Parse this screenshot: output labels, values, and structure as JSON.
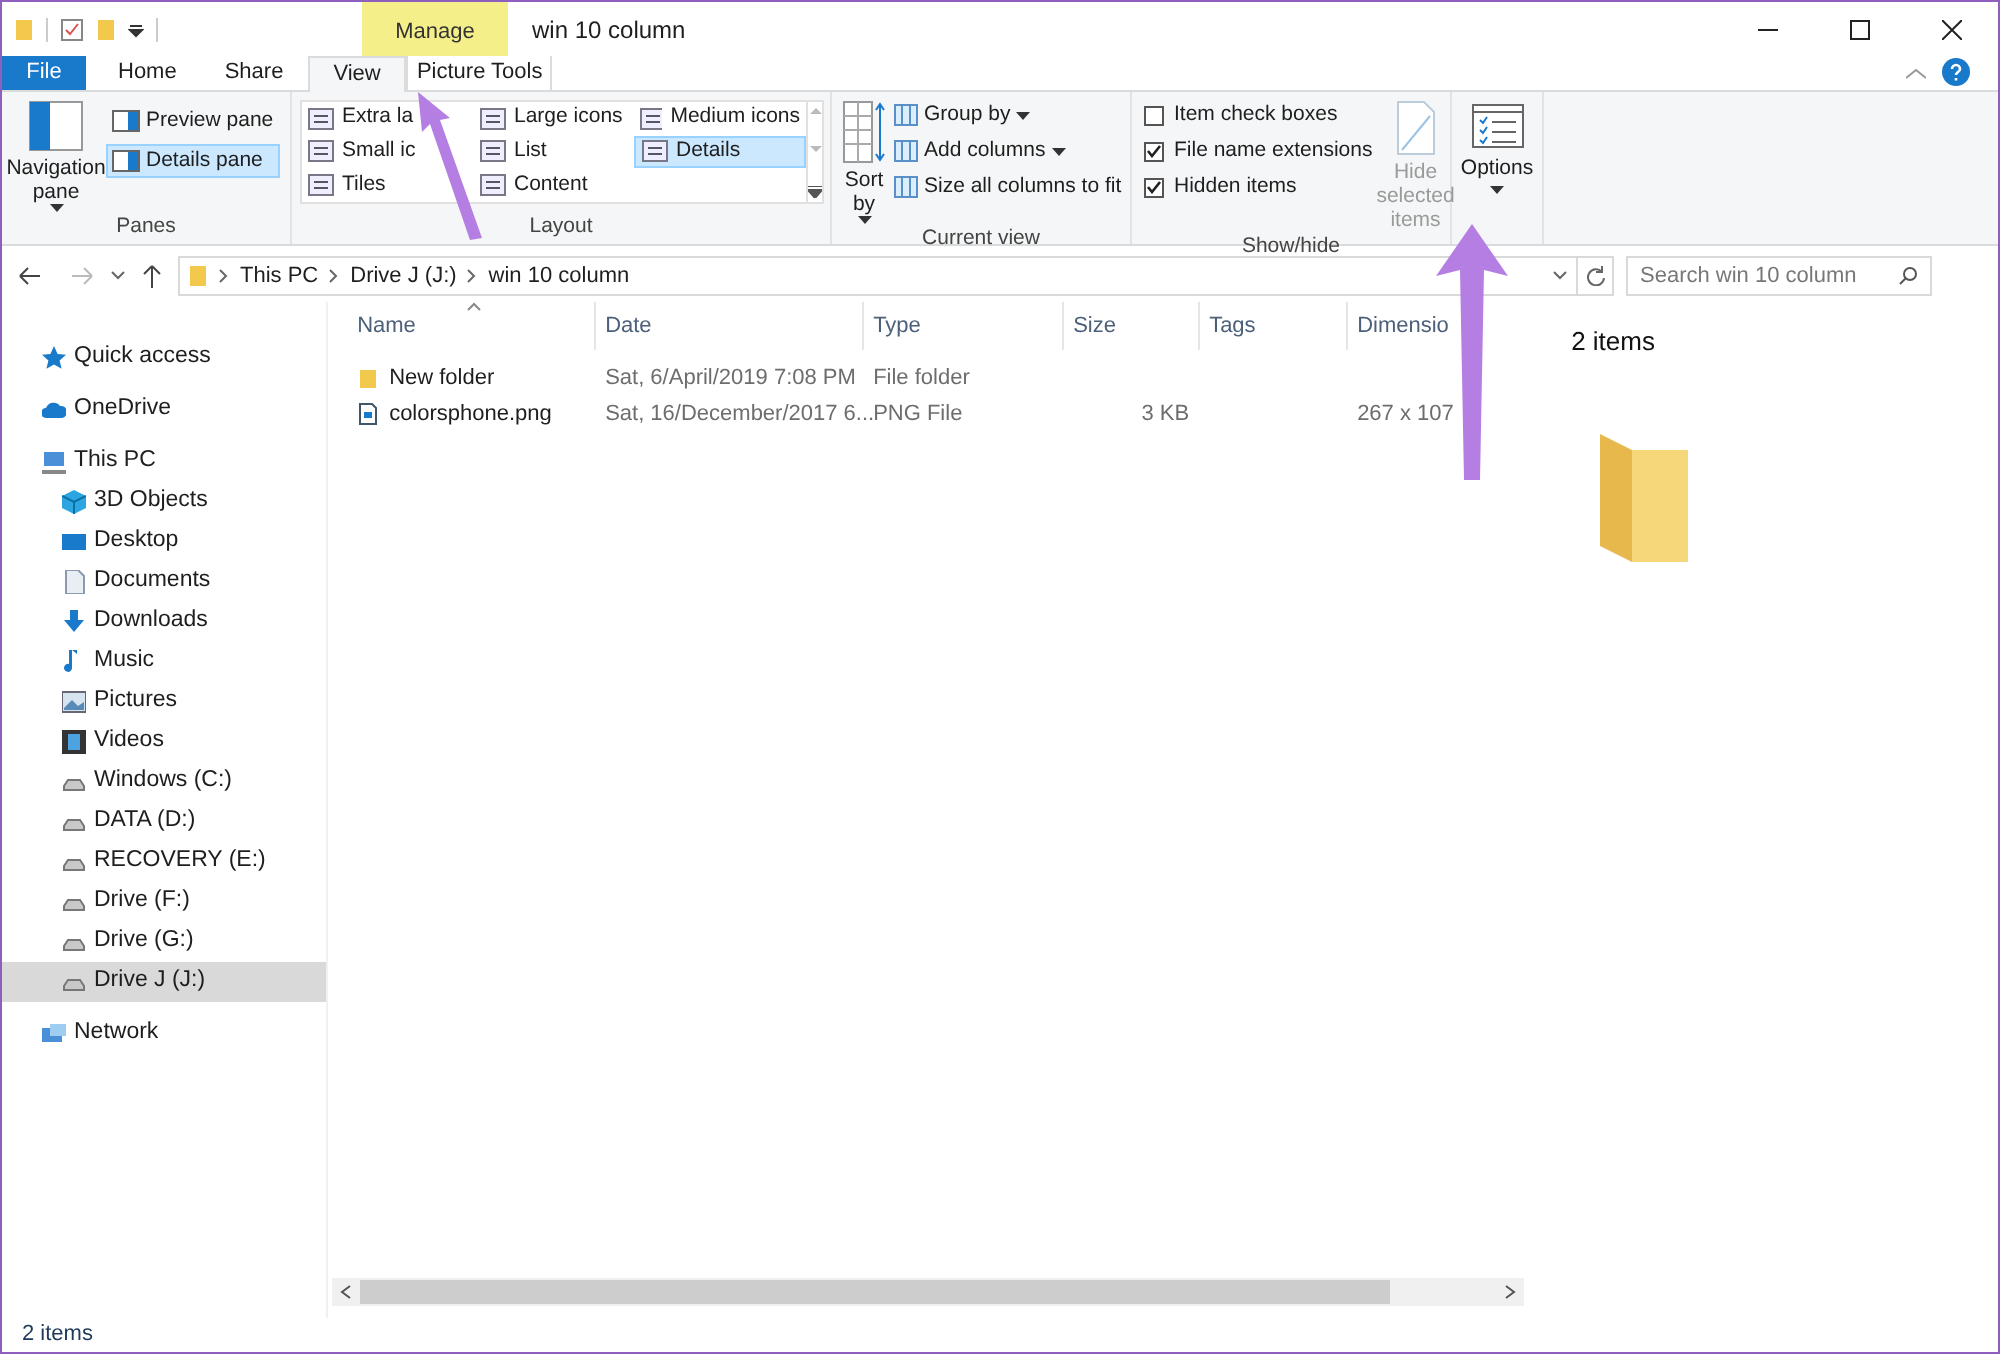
{
  "window": {
    "title": "win 10 column",
    "contextual_tab": "Manage"
  },
  "tabs": [
    {
      "label": "File",
      "kind": "file",
      "selected": false
    },
    {
      "label": "Home",
      "kind": "tab",
      "selected": false
    },
    {
      "label": "Share",
      "kind": "tab",
      "selected": false
    },
    {
      "label": "View",
      "kind": "tab",
      "selected": true
    },
    {
      "label": "Picture Tools",
      "kind": "context",
      "selected": false
    }
  ],
  "ribbon": {
    "panes": {
      "label": "Panes",
      "navigation": "Navigation pane",
      "items": [
        {
          "label": "Preview pane",
          "selected": false
        },
        {
          "label": "Details pane",
          "selected": true
        }
      ]
    },
    "layout": {
      "label": "Layout",
      "items": [
        {
          "label": "Extra la",
          "selected": false
        },
        {
          "label": "Large icons",
          "selected": false
        },
        {
          "label": "Medium icons",
          "selected": false
        },
        {
          "label": "Small ic",
          "selected": false
        },
        {
          "label": "List",
          "selected": false
        },
        {
          "label": "Details",
          "selected": true
        },
        {
          "label": "Tiles",
          "selected": false
        },
        {
          "label": "Content",
          "selected": false
        }
      ]
    },
    "current_view": {
      "label": "Current view",
      "sort": "Sort by",
      "items": [
        "Group by",
        "Add columns",
        "Size all columns to fit"
      ]
    },
    "show_hide": {
      "label": "Show/hide",
      "checkboxes": [
        {
          "label": "Item check boxes",
          "checked": false
        },
        {
          "label": "File name extensions",
          "checked": true
        },
        {
          "label": "Hidden items",
          "checked": true
        }
      ],
      "hide_selected": {
        "label": "Hide selected items",
        "disabled": true
      }
    },
    "options": {
      "label": "Options"
    }
  },
  "address": {
    "crumbs": [
      "This PC",
      "Drive J (J:)",
      "win 10 column"
    ],
    "search_placeholder": "Search win 10 column"
  },
  "sidebar": [
    {
      "label": "Quick access",
      "kind": "star",
      "selected": false
    },
    {
      "label": "OneDrive",
      "kind": "cloud",
      "selected": false
    },
    {
      "label": "This PC",
      "kind": "pc",
      "selected": false,
      "children": [
        {
          "label": "3D Objects",
          "kind": "cube",
          "selected": false
        },
        {
          "label": "Desktop",
          "kind": "desktop",
          "selected": false
        },
        {
          "label": "Documents",
          "kind": "document",
          "selected": false
        },
        {
          "label": "Downloads",
          "kind": "download",
          "selected": false
        },
        {
          "label": "Music",
          "kind": "music",
          "selected": false
        },
        {
          "label": "Pictures",
          "kind": "picture",
          "selected": false
        },
        {
          "label": "Videos",
          "kind": "video",
          "selected": false
        },
        {
          "label": "Windows (C:)",
          "kind": "drive",
          "selected": false
        },
        {
          "label": "DATA (D:)",
          "kind": "drive",
          "selected": false
        },
        {
          "label": "RECOVERY (E:)",
          "kind": "drive",
          "selected": false
        },
        {
          "label": "Drive (F:)",
          "kind": "drive",
          "selected": false
        },
        {
          "label": "Drive (G:)",
          "kind": "drive",
          "selected": false
        },
        {
          "label": "Drive J (J:)",
          "kind": "drive",
          "selected": true
        }
      ]
    },
    {
      "label": "Network",
      "kind": "network",
      "selected": false
    }
  ],
  "table": {
    "columns": [
      "Name",
      "Date",
      "Type",
      "Size",
      "Tags",
      "Dimensio"
    ],
    "rows": [
      {
        "kind": "folder",
        "cells": [
          "New folder",
          "Sat, 6/April/2019  7:08 PM",
          "File folder",
          "",
          "",
          ""
        ]
      },
      {
        "kind": "image",
        "cells": [
          "colorsphone.png",
          "Sat, 16/December/2017  6...",
          "PNG File",
          "3 KB",
          "",
          "267 x 107"
        ]
      }
    ]
  },
  "details_pane": {
    "title": "2 items"
  },
  "status_bar": {
    "text": "2 items"
  }
}
